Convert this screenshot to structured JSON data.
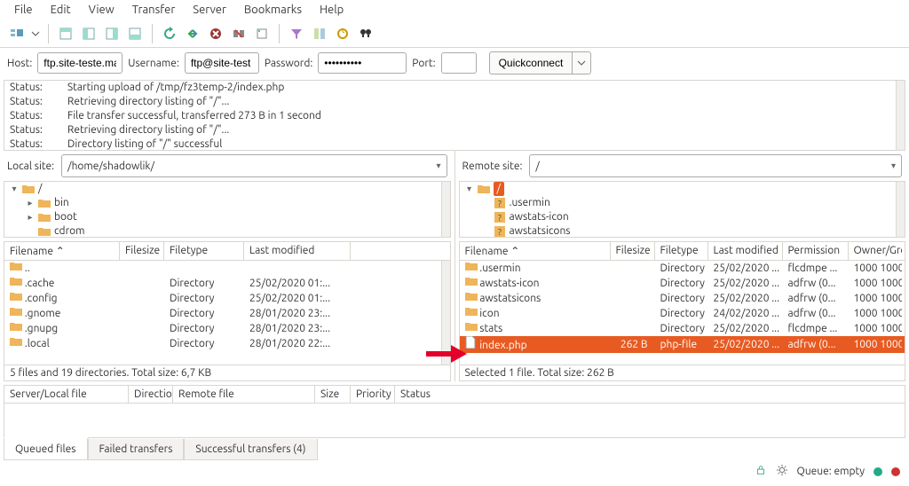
{
  "menu": [
    "File",
    "Edit",
    "View",
    "Transfer",
    "Server",
    "Bookmarks",
    "Help"
  ],
  "conn": {
    "host_lbl": "Host:",
    "host": "ftp.site-teste.ma",
    "user_lbl": "Username:",
    "user": "ftp@site-test",
    "pass_lbl": "Password:",
    "pass": "••••••••••",
    "port_lbl": "Port:",
    "port": "",
    "qc": "Quickconnect"
  },
  "log": [
    [
      "Status:",
      "Starting upload of /tmp/fz3temp-2/index.php"
    ],
    [
      "Status:",
      "Retrieving directory listing of \"/\"..."
    ],
    [
      "Status:",
      "File transfer successful, transferred 273 B in 1 second"
    ],
    [
      "Status:",
      "Retrieving directory listing of \"/\"..."
    ],
    [
      "Status:",
      "Directory listing of \"/\" successful"
    ]
  ],
  "local": {
    "lbl": "Local site:",
    "path": "/home/shadowlik/",
    "tree": [
      {
        "d": 0,
        "exp": "▾",
        "t": "folder",
        "n": "/"
      },
      {
        "d": 1,
        "exp": "▸",
        "t": "folder",
        "n": "bin"
      },
      {
        "d": 1,
        "exp": "▸",
        "t": "folder",
        "n": "boot"
      },
      {
        "d": 1,
        "exp": "",
        "t": "folder",
        "n": "cdrom"
      }
    ],
    "cols": [
      "Filename ⌃",
      "Filesize",
      "Filetype",
      "Last modified"
    ],
    "rows": [
      {
        "n": "..",
        "s": "",
        "t": "",
        "m": ""
      },
      {
        "n": ".cache",
        "s": "",
        "t": "Directory",
        "m": "25/02/2020 01:..."
      },
      {
        "n": ".config",
        "s": "",
        "t": "Directory",
        "m": "25/02/2020 01:..."
      },
      {
        "n": ".gnome",
        "s": "",
        "t": "Directory",
        "m": "28/01/2020 23:..."
      },
      {
        "n": ".gnupg",
        "s": "",
        "t": "Directory",
        "m": "28/01/2020 23:..."
      },
      {
        "n": ".local",
        "s": "",
        "t": "Directory",
        "m": "28/01/2020 22:..."
      }
    ],
    "status": "5 files and 19 directories. Total size: 6,7 KB"
  },
  "remote": {
    "lbl": "Remote site:",
    "path": "/",
    "tree": [
      {
        "d": 0,
        "exp": "▾",
        "sel": true,
        "t": "folder",
        "n": "/"
      },
      {
        "d": 1,
        "exp": "",
        "t": "unknown",
        "n": ".usermin"
      },
      {
        "d": 1,
        "exp": "",
        "t": "unknown",
        "n": "awstats-icon"
      },
      {
        "d": 1,
        "exp": "",
        "t": "unknown",
        "n": "awstatsicons"
      }
    ],
    "cols": [
      "Filename ⌃",
      "Filesize",
      "Filetype",
      "Last modified",
      "Permission",
      "Owner/Gro"
    ],
    "rows": [
      {
        "n": ".usermin",
        "s": "",
        "t": "Directory",
        "m": "25/02/2020 ...",
        "p": "flcdmpe ...",
        "o": "1000 1000",
        "i": "folder"
      },
      {
        "n": "awstats-icon",
        "s": "",
        "t": "Directory",
        "m": "25/02/2020 ...",
        "p": "adfrw (0...",
        "o": "1000 1000",
        "i": "folder"
      },
      {
        "n": "awstatsicons",
        "s": "",
        "t": "Directory",
        "m": "25/02/2020 ...",
        "p": "adfrw (0...",
        "o": "1000 1000",
        "i": "folder"
      },
      {
        "n": "icon",
        "s": "",
        "t": "Directory",
        "m": "24/02/2020 ...",
        "p": "adfrw (0...",
        "o": "1000 1000",
        "i": "folder"
      },
      {
        "n": "stats",
        "s": "",
        "t": "Directory",
        "m": "25/02/2020 ...",
        "p": "flcdmpe ...",
        "o": "1000 1000",
        "i": "folder"
      },
      {
        "n": "index.php",
        "s": "262 B",
        "t": "php-file",
        "m": "25/02/2020 ...",
        "p": "adfrw (0...",
        "o": "1000 1000",
        "i": "file",
        "sel": true
      }
    ],
    "status": "Selected 1 file. Total size: 262 B"
  },
  "queue_cols": [
    "Server/Local file",
    "Directio",
    "Remote file",
    "Size",
    "Priority",
    "Status"
  ],
  "tabs": [
    "Queued files",
    "Failed transfers",
    "Successful transfers (4)"
  ],
  "statusbar": {
    "queue": "Queue: empty"
  }
}
